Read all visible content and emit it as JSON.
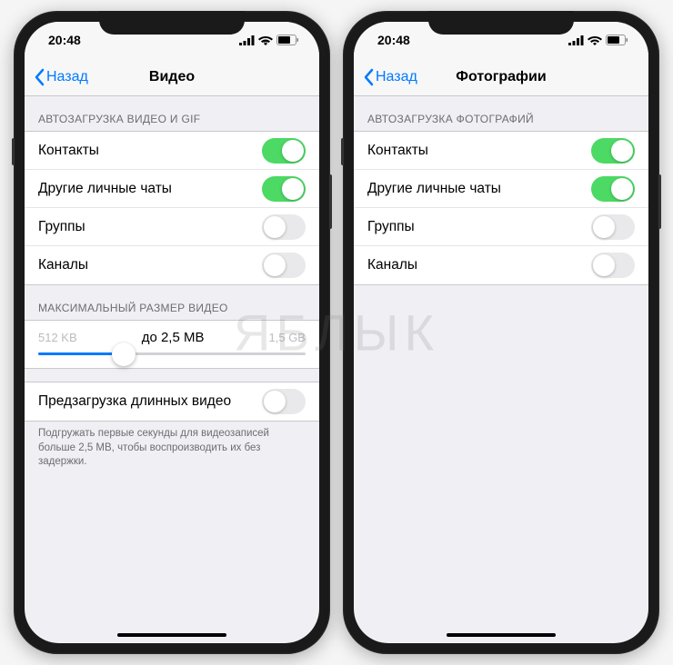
{
  "watermark": "ЯБЛЫК",
  "status": {
    "time": "20:48"
  },
  "phone_left": {
    "nav": {
      "back": "Назад",
      "title": "Видео"
    },
    "section1": {
      "header": "АВТОЗАГРУЗКА ВИДЕО И GIF",
      "rows": [
        {
          "label": "Контакты",
          "on": true
        },
        {
          "label": "Другие личные чаты",
          "on": true
        },
        {
          "label": "Группы",
          "on": false
        },
        {
          "label": "Каналы",
          "on": false
        }
      ]
    },
    "section2": {
      "header": "МАКСИМАЛЬНЫЙ РАЗМЕР ВИДЕО",
      "min": "512 KB",
      "value": "до 2,5 MB",
      "max": "1,5 GB"
    },
    "section3": {
      "row": {
        "label": "Предзагрузка длинных видео",
        "on": false
      },
      "footer": "Подгружать первые секунды для видеозаписей больше 2,5 MB, чтобы воспроизводить их без задержки."
    }
  },
  "phone_right": {
    "nav": {
      "back": "Назад",
      "title": "Фотографии"
    },
    "section1": {
      "header": "АВТОЗАГРУЗКА ФОТОГРАФИЙ",
      "rows": [
        {
          "label": "Контакты",
          "on": true
        },
        {
          "label": "Другие личные чаты",
          "on": true
        },
        {
          "label": "Группы",
          "on": false
        },
        {
          "label": "Каналы",
          "on": false
        }
      ]
    }
  }
}
